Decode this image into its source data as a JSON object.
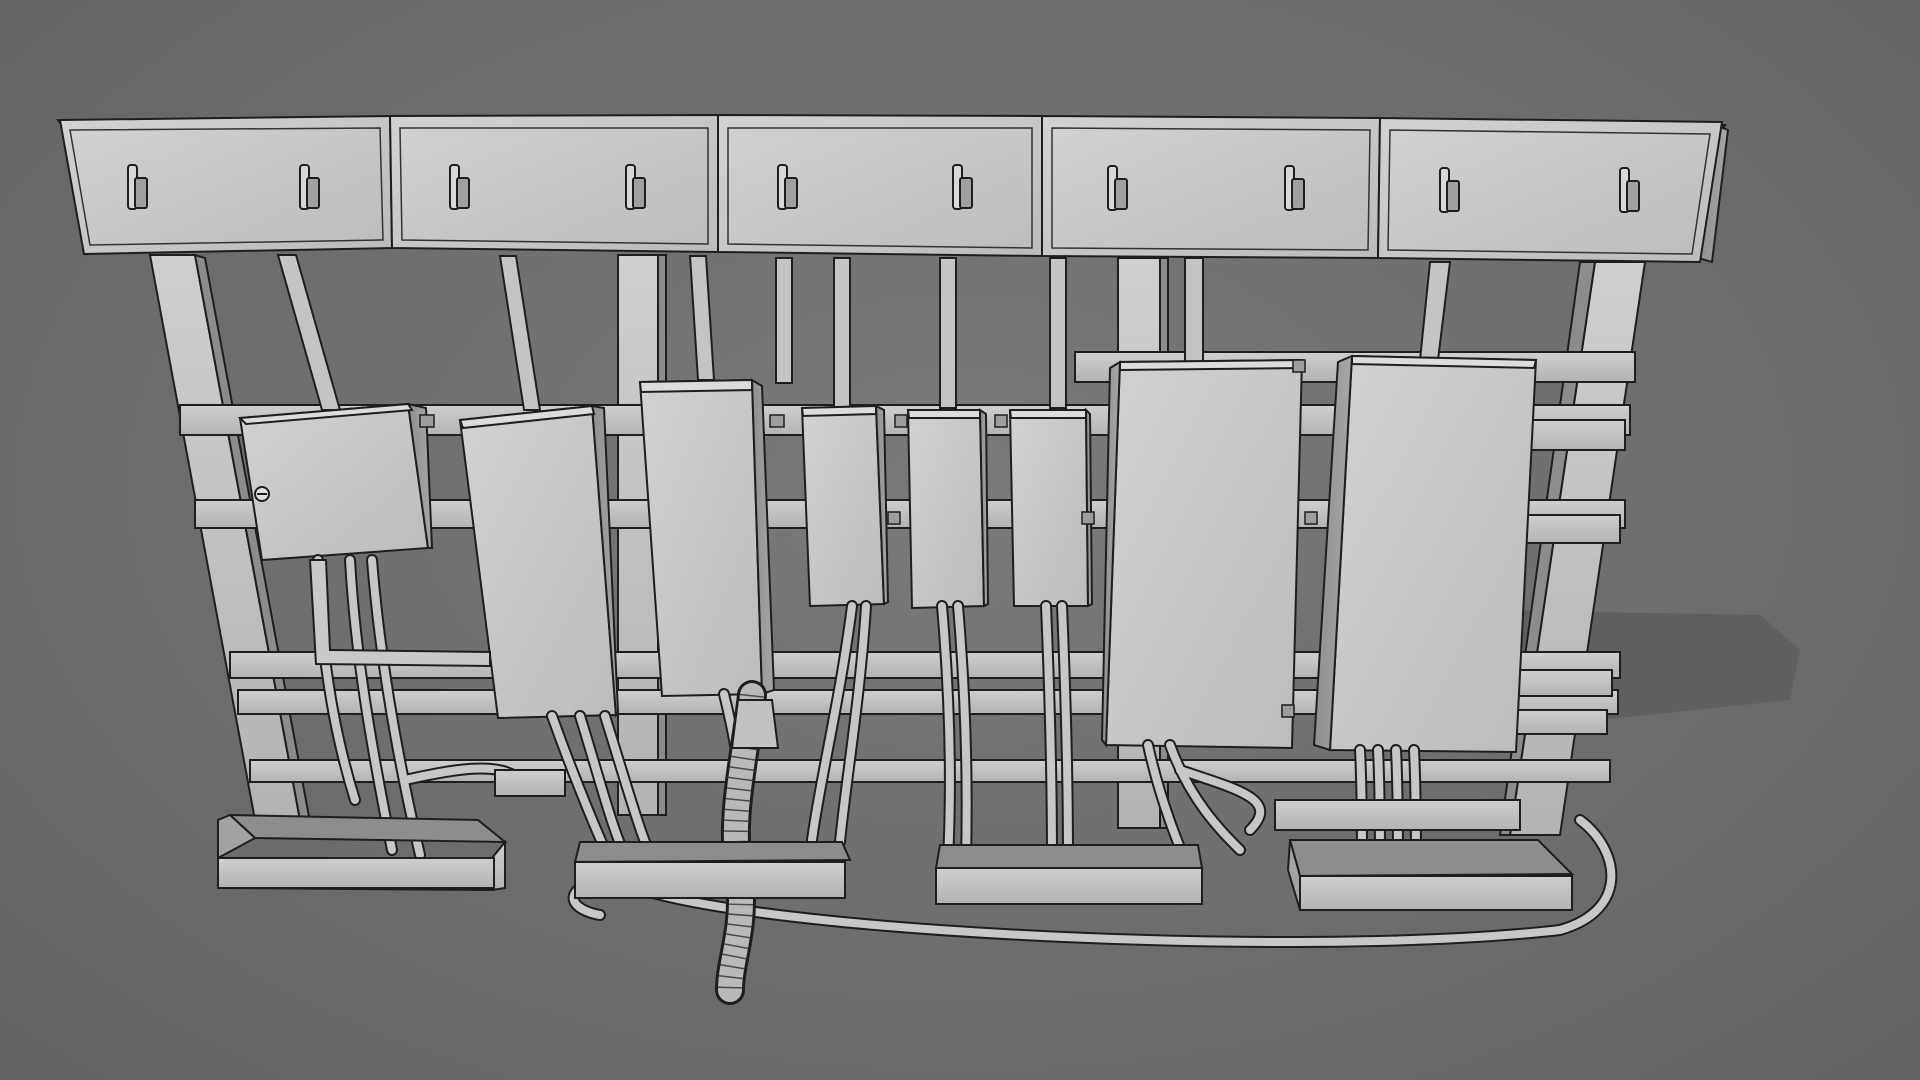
{
  "scene": {
    "subject": "",
    "render_style": "clay-wireframe",
    "colors": {
      "background": "#6e6e6e",
      "surface": "#c9c9c9",
      "surface_shade": "#a9a9a9",
      "edge": "#1e1e1e",
      "shadow": "#5c5c5c"
    },
    "counts": {
      "overhead_trays": 5,
      "tray_handles": 10,
      "wall_enclosures": 8,
      "floor_troughs": 4
    }
  }
}
